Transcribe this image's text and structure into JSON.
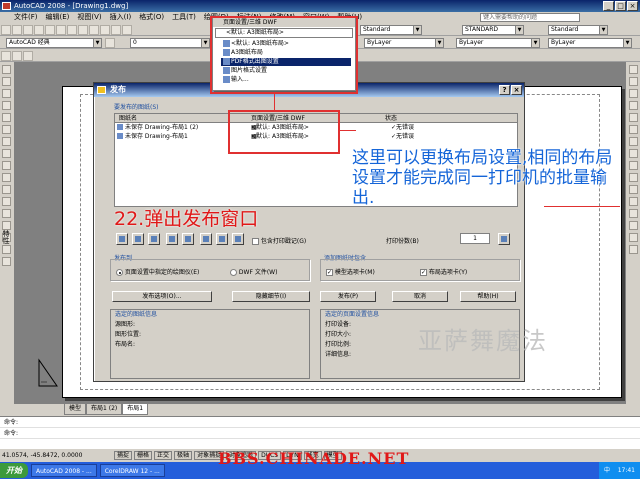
{
  "window": {
    "title": "AutoCAD 2008 - [Drawing1.dwg]"
  },
  "menu": {
    "items": [
      "文件(F)",
      "编辑(E)",
      "视图(V)",
      "插入(I)",
      "格式(O)",
      "工具(T)",
      "绘图(D)",
      "标注(N)",
      "修改(M)",
      "窗口(W)",
      "帮助(H)"
    ],
    "help_placeholder": "键入需要帮助的问题"
  },
  "toolbar": {
    "workspace": "AutoCAD 经典",
    "textstyle": "Standard",
    "dimstyle": "STANDARD",
    "tablestyle": "Standard",
    "layer_color": "ByLayer",
    "layer_linetype": "ByLayer",
    "layer_lineweight": "ByLayer",
    "layer_name": "0"
  },
  "side": {
    "vertical_label": "特性"
  },
  "popup": {
    "header": "页面设置/三维 DWF",
    "current": "<默认: A3图纸布局>",
    "options": [
      "<默认: A3图纸布局>",
      "A3图纸布局",
      "PDF格式出图设置",
      "图片格式设置",
      "输入..."
    ],
    "selected_index": 2
  },
  "dialog": {
    "title": "发布",
    "sheets_label": "要发布的图纸(S)",
    "columns": [
      "图纸名",
      "页面设置/三维 DWF",
      "状态"
    ],
    "rows": [
      {
        "name": "未保存 Drawing-布局1 (2)",
        "setup": "<默认: A3图纸布局>",
        "status": "无错误"
      },
      {
        "name": "未保存 Drawing-布局1",
        "setup": "<默认: A3图纸布局>",
        "status": "无错误"
      }
    ],
    "include_stamp": "包含打印戳记(G)",
    "copies_label": "打印份数(B)",
    "copies_value": "1",
    "publish_to": {
      "title": "发布到",
      "option_plotter": "页面设置中指定的绘图仪(E)",
      "option_dwf": "DWF 文件(W)"
    },
    "add_sheets": {
      "title": "添加图纸时包含",
      "model_tab": "模型选项卡(M)",
      "layout_tab": "布局选项卡(Y)"
    },
    "buttons": {
      "publish_options": "发布选项(O)...",
      "hide_details": "隐藏细节(I)",
      "publish": "发布(P)",
      "cancel": "取消",
      "help": "帮助(H)"
    },
    "selected_sheet_info": {
      "title": "选定的图纸信息",
      "fields": [
        "源图形:",
        "图形位置:",
        "布局名:"
      ]
    },
    "page_setup_info": {
      "title": "选定的页面设置信息",
      "fields": [
        "打印设备:",
        "打印大小:",
        "打印比例:",
        "详细信息:"
      ]
    }
  },
  "annotations": {
    "blue_note": "这里可以更换布局设置,相同的布局设置才能完成同一打印机的批量输出.",
    "red_title": "22.弹出发布窗口",
    "watermark": "亚萨舞魔法",
    "bottom_watermark": "BBS.CHINADE.NET"
  },
  "layout_tabs": [
    "模型",
    "布局1 (2)",
    "布局1"
  ],
  "command": {
    "line1": "命令:",
    "line2": "命令:"
  },
  "status": {
    "coords": "41.0574, -45.8472, 0.0000",
    "toggles": [
      "捕捉",
      "栅格",
      "正交",
      "极轴",
      "对象捕捉",
      "对象追踪",
      "DUCS",
      "DYN",
      "线宽",
      "模型"
    ]
  },
  "taskbar": {
    "start": "开始",
    "tasks": [
      "AutoCAD 2008 - ...",
      "CorelDRAW 12 - ..."
    ],
    "ime": "中",
    "clock": "17:41"
  }
}
